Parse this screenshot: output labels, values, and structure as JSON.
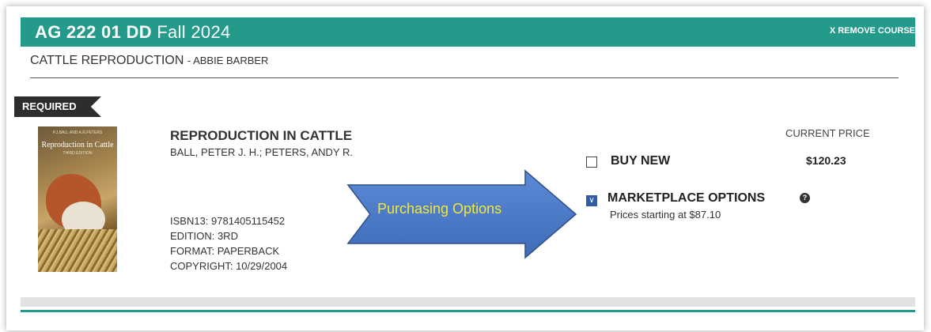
{
  "course": {
    "code": "AG 222 01 DD",
    "term": "Fall 2024",
    "remove_label": "X REMOVE COURSE",
    "title": "CATTLE REPRODUCTION",
    "instructor": "- ABBIE BARBER"
  },
  "book": {
    "requirement": "REQUIRED",
    "cover": {
      "authors": "P.J.BALL AND A.R.PETERS",
      "title": "Reproduction in Cattle",
      "edition": "THIRD EDITION"
    },
    "title": "REPRODUCTION IN CATTLE",
    "authors": "BALL, PETER J. H.; PETERS, ANDY R.",
    "isbn": "ISBN13: 9781405115452",
    "edition": "EDITION: 3RD",
    "format": "FORMAT: PAPERBACK",
    "copyright": "COPYRIGHT: 10/29/2004"
  },
  "annotation": {
    "arrow_label": "Purchasing Options",
    "arrow_color": "#4a78c4"
  },
  "purchase": {
    "current_price_label": "CURRENT PRICE",
    "buy_new_label": "BUY NEW",
    "buy_new_price": "$120.23",
    "buy_new_checked": false,
    "marketplace_label": "MARKETPLACE OPTIONS",
    "marketplace_checked": true,
    "marketplace_sub": "Prices starting at $87.10",
    "help_symbol": "?"
  },
  "colors": {
    "accent": "#249a8b",
    "checkbox_checked": "#2f5da8",
    "annotation_text": "#f0e83a"
  }
}
